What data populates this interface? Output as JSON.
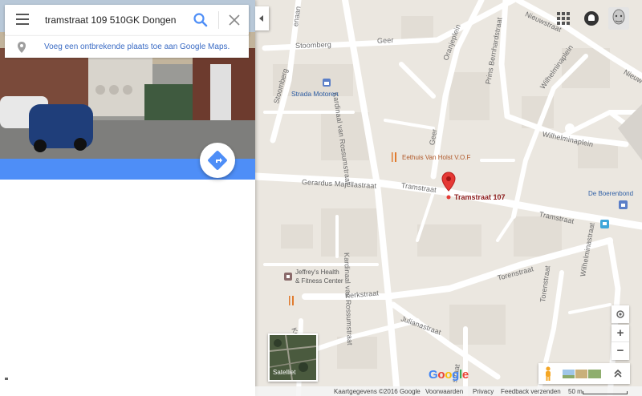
{
  "search": {
    "query": "tramstraat 109 510GK Dongen"
  },
  "suggestion": {
    "link_text": "Voeg een ontbrekende plaats toe aan Google Maps."
  },
  "map": {
    "marker_label": "Tramstraat 107",
    "streets": {
      "stoomberg_top": "Stoomberg",
      "geer_top": "Geer",
      "stoomberg_vert": "Stoomberg",
      "kardinaal_upper": "Kardinaal van Rossumstraat",
      "kardinaal_lower": "Kardinaal van Rossumstraat",
      "oranjeplein": "Oranjeplein",
      "prins_bernhard": "Prins Bernhardstraat",
      "wilhelminaplein_up": "Wilhelminaplein",
      "wilhelminaplein": "Wilhelminaplein",
      "nieuwstraat": "Nieuwstraat",
      "nieuw_right": "Nieuw",
      "geer_mid": "Geer",
      "gerardus": "Gerardus Majellastraat",
      "tramstraat_left": "Tramstraat",
      "tramstraat_right": "Tramstraat",
      "wilhelminastraat": "Wilhelminastraat",
      "torenstraat_h": "Torenstraat",
      "torenstraat_v": "Torenstraat",
      "kerkstraat": "Kerkstraat",
      "julianastraat": "Julianastraat",
      "kerk_vert": "Kerk",
      "straat_bottom": "straat",
      "jenaan": "enaan"
    },
    "pois": {
      "strada": "Strada Motoren",
      "eethuis": "Eethuis Van Holst V.O.F",
      "boerenbond": "De Boerenbond",
      "jeffreys_1": "Jeffrey's Health",
      "jeffreys_2": "& Fitness Center"
    }
  },
  "controls": {
    "zoom_in": "+",
    "zoom_out": "−",
    "satellite_label": "Satelliet",
    "google_letters": [
      "G",
      "o",
      "o",
      "g",
      "l",
      "e"
    ],
    "google_colors": [
      "#4285f4",
      "#ea4335",
      "#fbbc05",
      "#4285f4",
      "#34a853",
      "#ea4335"
    ]
  },
  "footer": {
    "copyright": "Kaartgegevens ©2016 Google",
    "terms": "Voorwaarden",
    "privacy": "Privacy",
    "feedback": "Feedback verzenden",
    "scale": "50 m"
  },
  "colors": {
    "accent": "#4e8ef7",
    "marker": "#e53935",
    "road": "#ffffff",
    "map_bg": "#ebe7e0",
    "block": "#e3ded6"
  }
}
